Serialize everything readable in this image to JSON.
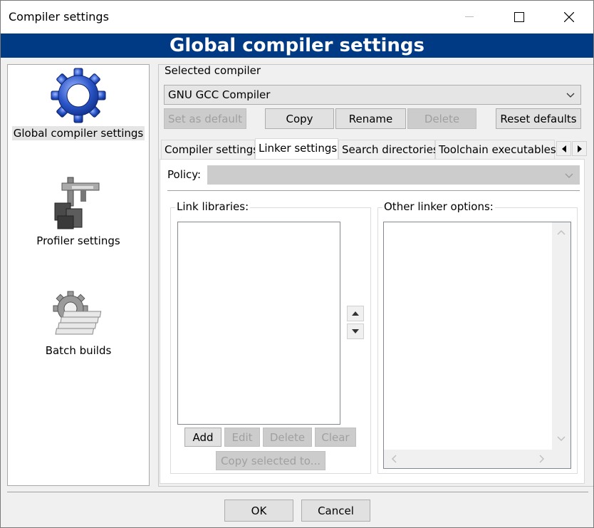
{
  "window": {
    "title": "Compiler settings"
  },
  "header": {
    "title": "Global compiler settings"
  },
  "nav": {
    "items": [
      {
        "label": "Global compiler settings",
        "icon": "gear-icon"
      },
      {
        "label": "Profiler settings",
        "icon": "profiler-icon"
      },
      {
        "label": "Batch builds",
        "icon": "batch-builds-icon"
      }
    ]
  },
  "compiler": {
    "section_label": "Selected compiler",
    "selected": "GNU GCC Compiler",
    "buttons": {
      "set_default": "Set as default",
      "copy": "Copy",
      "rename": "Rename",
      "delete": "Delete",
      "reset": "Reset defaults"
    }
  },
  "tabs": [
    {
      "label": "Compiler settings"
    },
    {
      "label": "Linker settings"
    },
    {
      "label": "Search directories"
    },
    {
      "label": "Toolchain executables"
    }
  ],
  "linker": {
    "policy_label": "Policy:",
    "policy_value": "",
    "link_libraries_label": "Link libraries:",
    "other_options_label": "Other linker options:",
    "buttons": {
      "add": "Add",
      "edit": "Edit",
      "delete": "Delete",
      "clear": "Clear",
      "copy_selected": "Copy selected to..."
    }
  },
  "footer": {
    "ok": "OK",
    "cancel": "Cancel"
  },
  "colors": {
    "header_bg": "#003a84",
    "gear_blue": "#2a55c8"
  }
}
